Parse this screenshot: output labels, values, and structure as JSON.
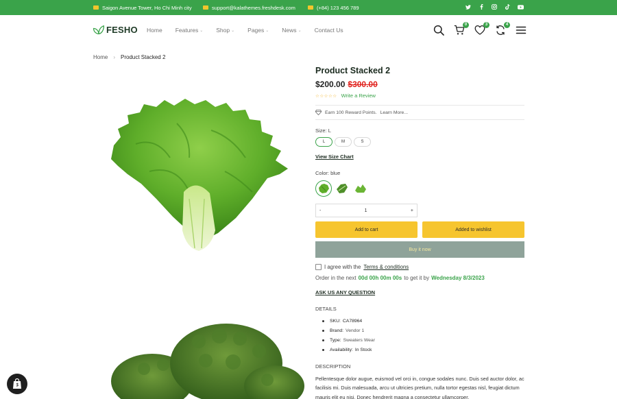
{
  "topbar": {
    "address": "Saigon Avenue Tower, Ho Chi Minh city",
    "email": "support@kalathemes.freshdesk.com",
    "phone": "(+84) 123 456 789",
    "social": [
      "twitter-icon",
      "facebook-icon",
      "instagram-icon",
      "tiktok-icon",
      "youtube-icon"
    ]
  },
  "header": {
    "logo_text": "FESHO",
    "nav": [
      {
        "label": "Home",
        "dropdown": false
      },
      {
        "label": "Features",
        "dropdown": true
      },
      {
        "label": "Shop",
        "dropdown": true
      },
      {
        "label": "Pages",
        "dropdown": true
      },
      {
        "label": "News",
        "dropdown": true
      },
      {
        "label": "Contact Us",
        "dropdown": false
      }
    ],
    "cart_count": "0",
    "wishlist_count": "3",
    "compare_count": "4"
  },
  "breadcrumb": {
    "home": "Home",
    "current": "Product Stacked 2"
  },
  "product": {
    "title": "Product Stacked 2",
    "price": "$200.00",
    "old_price": "$300.00",
    "review_link": "Write a Review",
    "reward": "Earn 100 Reward Points.",
    "reward_more": "Learn More...",
    "size_label": "Size: L",
    "sizes": [
      "L",
      "M",
      "S"
    ],
    "size_selected": "L",
    "size_chart": "View Size Chart",
    "color_label": "Color: blue",
    "quantity": "1",
    "qty_minus": "-",
    "qty_plus": "+",
    "add_to_cart": "Add to cart",
    "add_to_wishlist": "Added to wishlist",
    "buy_now": "Buy it now",
    "agree_text": "I agree with the",
    "terms": "Terms & conditions",
    "order_prefix": "Order in the next",
    "countdown": "00d 00h 00m 00s",
    "order_mid": "to get it by",
    "delivery_date": "Wednesday 8/3/2023",
    "ask": "ASK US ANY QUESTION",
    "details_heading": "DETAILS",
    "details": [
      {
        "key": "SKU:",
        "value": "CA78964"
      },
      {
        "key": "Brand:",
        "value": "Vendor 1"
      },
      {
        "key": "Type:",
        "value": "Sweaters Wear"
      },
      {
        "key": "Availability:",
        "value": "In Stock"
      }
    ],
    "description_heading": "DESCRIPTION",
    "description": "Pellentesque dolor augue, euismod vel orci in, congue sodales nunc. Duis sed auctor dolor, ac facilisis mi. Duis malesuada, arcu ut ultricies pretium, nulla tortor egestas nisl, feugiat dictum mauris elit eu nisi. Donec hendrerit magna a consectetur ullamcorper."
  },
  "colors": {
    "brand_green": "#3aa34a",
    "button_yellow": "#f6c52f",
    "buy_now_bg": "#8fa39a",
    "old_price_red": "#e0201b"
  }
}
